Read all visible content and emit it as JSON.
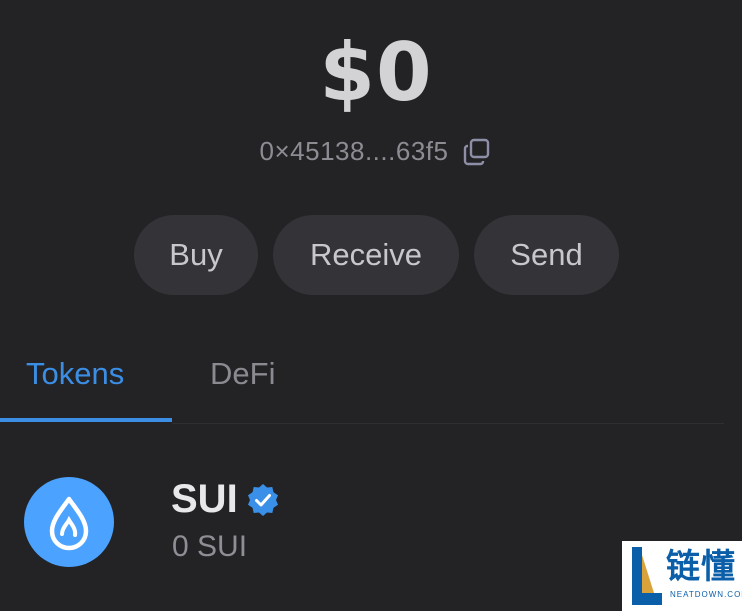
{
  "wallet": {
    "balance": "$0",
    "address": "0×45138....63f5"
  },
  "actions": {
    "buy_label": "Buy",
    "receive_label": "Receive",
    "send_label": "Send"
  },
  "tabs": [
    {
      "label": "Tokens",
      "active": true
    },
    {
      "label": "DeFi",
      "active": false
    }
  ],
  "tokens": [
    {
      "symbol": "SUI",
      "balance": "0 SUI",
      "verified": true,
      "icon": "sui-droplet-icon"
    }
  ],
  "watermark": {
    "text_cn": "链懂",
    "text_en": "NEATDOWN.COM"
  },
  "colors": {
    "background": "#232326",
    "button_bg": "#333338",
    "accent": "#3b8ee4",
    "sui_blue": "#4ca2ff"
  }
}
